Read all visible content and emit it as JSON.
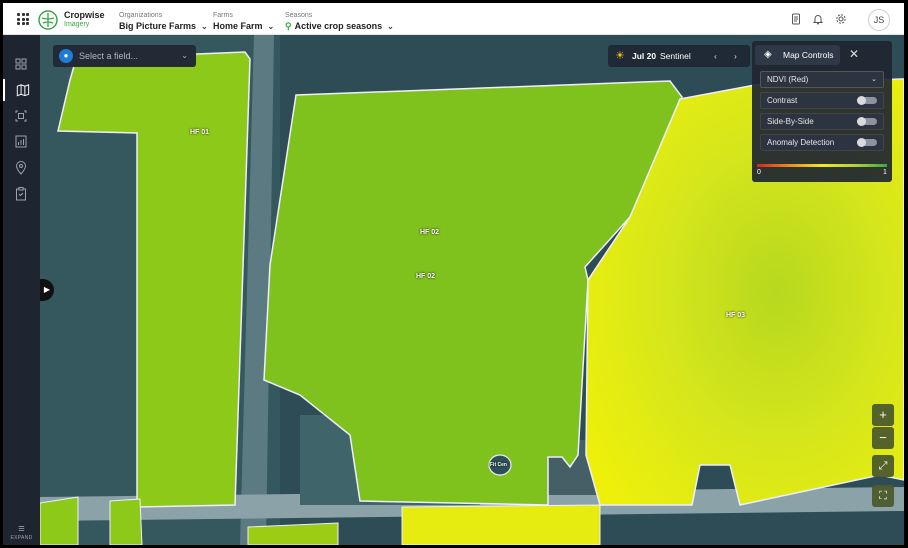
{
  "topbar": {
    "brand_name": "Cropwise",
    "brand_sub": "Imagery",
    "org_label": "Organizations",
    "org_value": "Big Picture Farms",
    "farm_label": "Farms",
    "farm_value": "Home Farm",
    "season_label": "Seasons",
    "season_value": "Active crop seasons",
    "avatar_initials": "JS",
    "icons": [
      "apps-grid-icon",
      "document-icon",
      "bell-icon",
      "gear-icon"
    ]
  },
  "sidebar": {
    "items": [
      "dashboard-icon",
      "map-icon",
      "scan-icon",
      "chart-icon",
      "location-pin-icon",
      "clipboard-icon"
    ],
    "active_index": 1,
    "expand_label": "EXPAND"
  },
  "map": {
    "field_select_placeholder": "Select a field...",
    "date": "Jul 20",
    "source": "Sentinel",
    "fields": [
      {
        "name": "HF 01"
      },
      {
        "name": "HF 02"
      },
      {
        "name": "HF 02"
      },
      {
        "name": "HF 03"
      }
    ],
    "small_label": "Fit Cen"
  },
  "map_controls": {
    "title": "Map Controls",
    "layer_value": "NDVI (Red)",
    "contrast_label": "Contrast",
    "side_by_side_label": "Side-By-Side",
    "anomaly_label": "Anomaly Detection",
    "contrast_on": false,
    "side_by_side_on": false,
    "anomaly_on": false,
    "legend_min": "0",
    "legend_max": "1",
    "legend_colors": [
      "#d7261d",
      "#f08a1f",
      "#f4e81f",
      "#b6d334",
      "#3aa845"
    ]
  },
  "zoom": {
    "in": "+",
    "out": "−"
  }
}
